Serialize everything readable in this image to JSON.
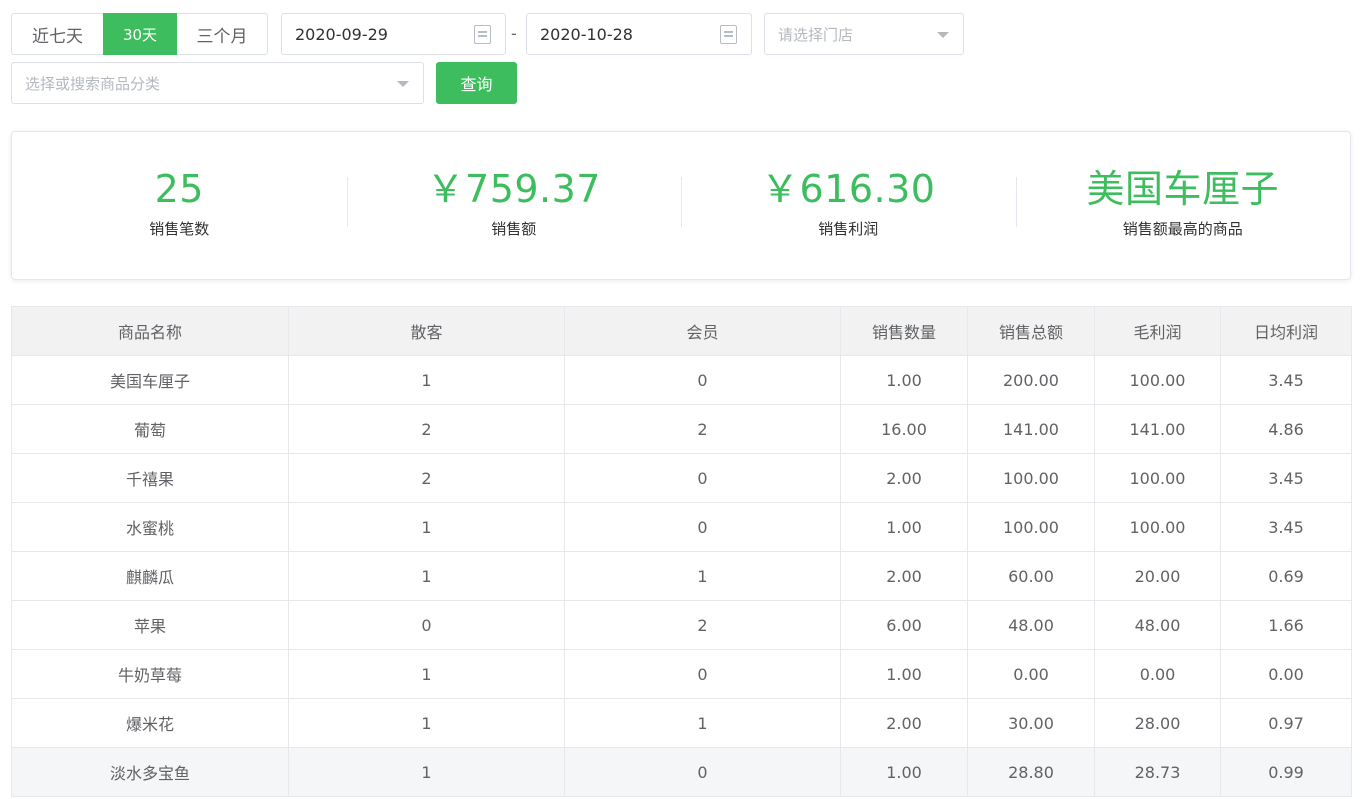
{
  "filters": {
    "quick_ranges": [
      {
        "label": "近七天",
        "active": false
      },
      {
        "label": "30天",
        "active": true
      },
      {
        "label": "三个月",
        "active": false
      }
    ],
    "start_date": "2020-09-29",
    "end_date": "2020-10-28",
    "date_separator": "-",
    "store_placeholder": "请选择门店",
    "category_placeholder": "选择或搜索商品分类",
    "query_label": "查询",
    "accent_color": "#3dbd5e"
  },
  "summary": {
    "sales_count": {
      "value": "25",
      "label": "销售笔数"
    },
    "sales_amount": {
      "value": "￥759.37",
      "label": "销售额"
    },
    "sales_profit": {
      "value": "￥616.30",
      "label": "销售利润"
    },
    "top_product": {
      "value": "美国车厘子",
      "label": "销售额最高的商品"
    }
  },
  "table": {
    "columns": [
      "商品名称",
      "散客",
      "会员",
      "销售数量",
      "销售总额",
      "毛利润",
      "日均利润"
    ],
    "rows": [
      [
        "美国车厘子",
        "1",
        "0",
        "1.00",
        "200.00",
        "100.00",
        "3.45"
      ],
      [
        "葡萄",
        "2",
        "2",
        "16.00",
        "141.00",
        "141.00",
        "4.86"
      ],
      [
        "千禧果",
        "2",
        "0",
        "2.00",
        "100.00",
        "100.00",
        "3.45"
      ],
      [
        "水蜜桃",
        "1",
        "0",
        "1.00",
        "100.00",
        "100.00",
        "3.45"
      ],
      [
        "麒麟瓜",
        "1",
        "1",
        "2.00",
        "60.00",
        "20.00",
        "0.69"
      ],
      [
        "苹果",
        "0",
        "2",
        "6.00",
        "48.00",
        "48.00",
        "1.66"
      ],
      [
        "牛奶草莓",
        "1",
        "0",
        "1.00",
        "0.00",
        "0.00",
        "0.00"
      ],
      [
        "爆米花",
        "1",
        "1",
        "2.00",
        "30.00",
        "28.00",
        "0.97"
      ],
      [
        "淡水多宝鱼",
        "1",
        "0",
        "1.00",
        "28.80",
        "28.73",
        "0.99"
      ]
    ]
  }
}
